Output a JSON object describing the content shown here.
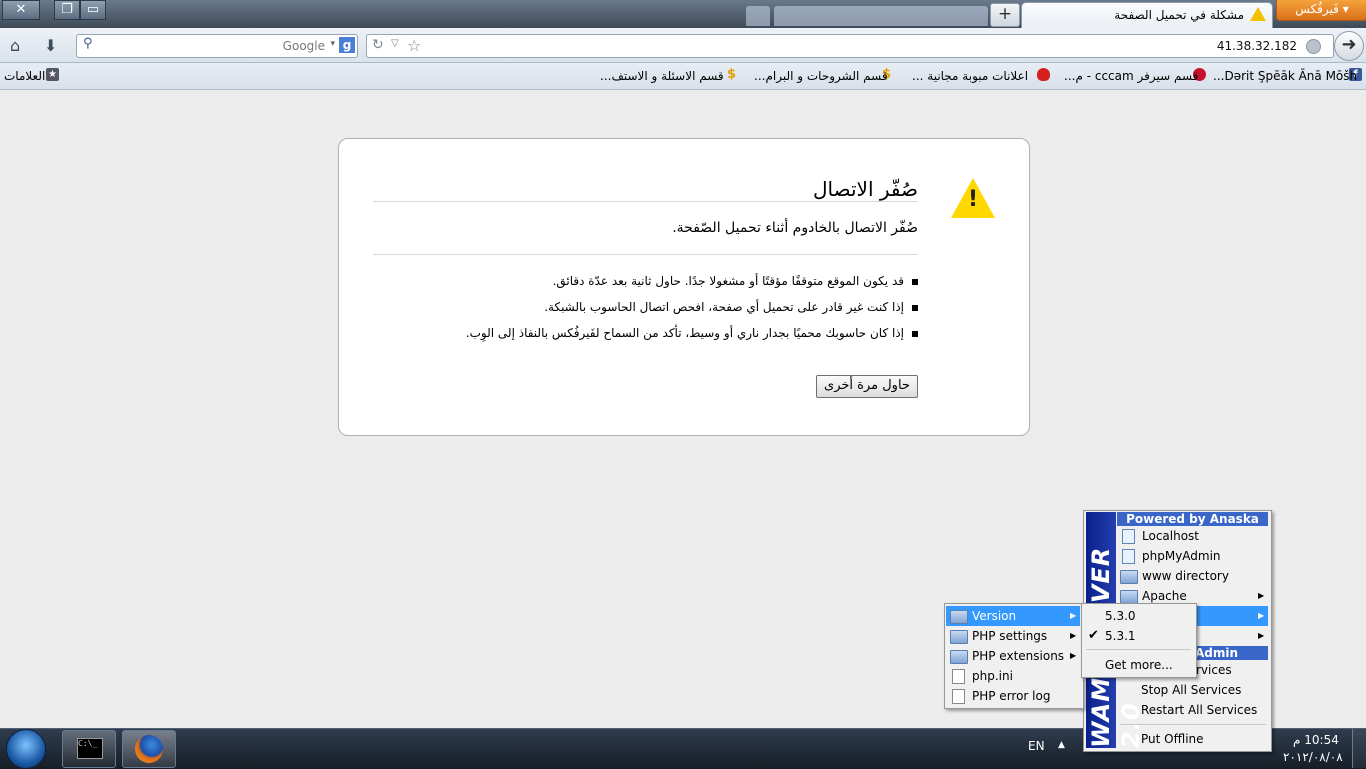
{
  "browser": {
    "app_button": "فَيرفُكس",
    "window_controls": {
      "close": "✕",
      "restore": "❐",
      "minimize": "▭"
    },
    "active_tab_title": "مشكلة في تحميل الصفحة",
    "new_tab": "+",
    "url": "41.38.32.182",
    "search_placeholder": "Google",
    "search_engine_logo": "g",
    "bookmarks_label": "العلامات",
    "bookmarks": [
      "Dərit Şpēāk Ānā Mōšh...",
      "قسم سيرفر cccam - م...",
      "اعلانات مبوبة مجانية ...",
      "قسم الشروحات و البرام...",
      "قسم الاسئلة و الاستف..."
    ]
  },
  "error_page": {
    "title": "صُفّر الاتصال",
    "description": "صُفّر الاتصال بالخادوم أثناء تحميل الصّفحة.",
    "items": [
      "قد يكون الموقع متوقفًا مؤقتًا أو مشغولا جدًا. حاول ثانية بعد عدّة دقائق.",
      "إذا كنت غير قادر على تحميل أي صفحة، افحص اتصال الحاسوب بالشبكة.",
      "إذا كان حاسوبك محميًا بجدار ناري أو وسيط، تأكد من السماح لفَيرفُكس بالنفاذ إلى الوِب."
    ],
    "retry_button": "حاول مرة أخرى"
  },
  "wamp_menu": {
    "brand_vertical": "WAMPSERVER 2.0",
    "header": "Powered by Anaska",
    "items": [
      "Localhost",
      "phpMyAdmin",
      "www directory",
      "Apache"
    ],
    "admin_header_partial": "Admin",
    "services_partial": "rvices",
    "stop_all": "Stop All Services",
    "restart_all": "Restart All Services",
    "put_offline": "Put Offline"
  },
  "php_menu": {
    "items": [
      "Version",
      "PHP settings",
      "PHP extensions",
      "php.ini",
      "PHP error log"
    ]
  },
  "version_menu": {
    "items": [
      "5.3.0",
      "5.3.1"
    ],
    "checked": "5.3.1",
    "get_more": "Get more..."
  },
  "taskbar": {
    "language": "EN",
    "time": "10:54 م",
    "date": "٢٠١٢/٠٨/٠٨"
  }
}
